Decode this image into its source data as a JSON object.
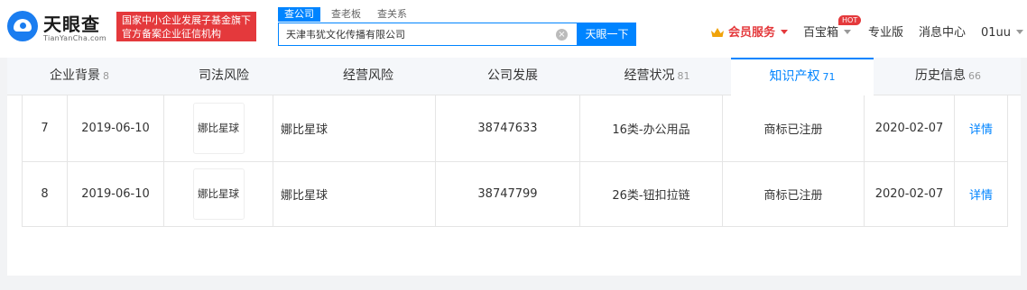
{
  "header": {
    "logo_text": "天眼查",
    "logo_sub": "TianYanCha.com",
    "banner_line1": "国家中小企业发展子基金旗下",
    "banner_line2": "官方备案企业征信机构",
    "search_tabs": [
      "查公司",
      "查老板",
      "查关系"
    ],
    "search_value": "天津韦犹文化传播有限公司",
    "search_button": "天眼一下",
    "clear_icon": "×",
    "nav": {
      "vip": "会员服务",
      "treasure": "百宝箱",
      "hot": "HOT",
      "pro": "专业版",
      "messages": "消息中心",
      "user": "01uu"
    }
  },
  "tabs": [
    {
      "label": "企业背景",
      "count": "8"
    },
    {
      "label": "司法风险",
      "count": ""
    },
    {
      "label": "经营风险",
      "count": ""
    },
    {
      "label": "公司发展",
      "count": ""
    },
    {
      "label": "经营状况",
      "count": "81"
    },
    {
      "label": "知识产权",
      "count": "71"
    },
    {
      "label": "历史信息",
      "count": "66"
    }
  ],
  "active_tab": "知识产权",
  "rows": [
    {
      "index": "7",
      "date": "2019-06-10",
      "thumb": "娜比星球",
      "name": "娜比星球",
      "reg_no": "38747633",
      "class": "16类-办公用品",
      "status": "商标已注册",
      "pub_date": "2020-02-07",
      "action": "详情"
    },
    {
      "index": "8",
      "date": "2019-06-10",
      "thumb": "娜比星球",
      "name": "娜比星球",
      "reg_no": "38747799",
      "class": "26类-钮扣拉链",
      "status": "商标已注册",
      "pub_date": "2020-02-07",
      "action": "详情"
    }
  ]
}
